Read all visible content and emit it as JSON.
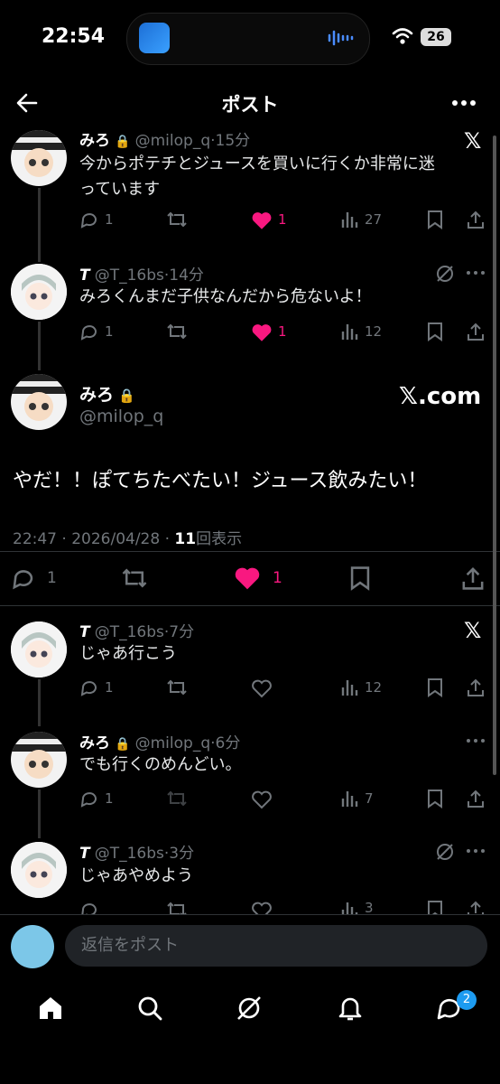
{
  "status_bar": {
    "time": "22:54",
    "battery": "26"
  },
  "header": {
    "title": "ポスト"
  },
  "tweets": [
    {
      "name": "みろ",
      "handle": "@milop_q",
      "time": "15分",
      "text_line1": "今からポテチとジュースを買いに行くか非常に迷",
      "text_line2": "っています",
      "replies": "1",
      "likes": "1",
      "views": "27"
    },
    {
      "name": "T",
      "handle": "@T_16bs",
      "time": "14分",
      "text": "みろくんまだ子供なんだから危ないよ！",
      "replies": "1",
      "likes": "1",
      "views": "12"
    }
  ],
  "main_post": {
    "name": "みろ",
    "handle": "@milop_q",
    "brand": "𝕏.com",
    "text": "やだ！！ぽてちたべたい！ジュース飲みたい！",
    "meta_prefix": "22:47 · 2026/04/28 · ",
    "view_count": "11",
    "view_label": "回表示",
    "replies": "1",
    "likes": "1"
  },
  "replies_below": [
    {
      "name": "T",
      "handle": "@T_16bs",
      "time": "7分",
      "text": "じゃあ行こう",
      "replies": "1",
      "views": "12"
    },
    {
      "name": "みろ",
      "handle": "@milop_q",
      "time": "6分",
      "text": "でも行くのめんどい。",
      "replies": "1",
      "views": "7"
    },
    {
      "name": "T",
      "handle": "@T_16bs",
      "time": "3分",
      "text": "じゃあやめよう",
      "views": "3"
    }
  ],
  "reply_bar": {
    "placeholder": "返信をポスト"
  },
  "nav": {
    "messages_badge": "2"
  },
  "colors": {
    "like": "#f91880",
    "accent": "#1d9bf0"
  }
}
